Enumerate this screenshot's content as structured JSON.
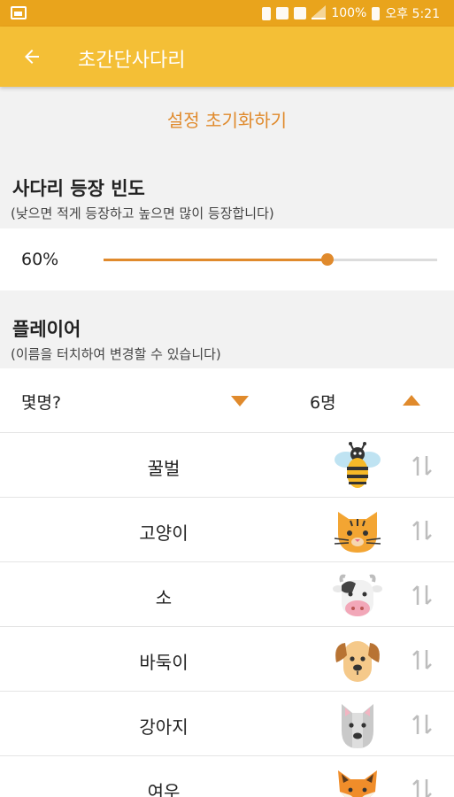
{
  "status_bar": {
    "battery": "100%",
    "time": "오후 5:21"
  },
  "app_bar": {
    "title": "초간단사다리",
    "back_icon": "back-arrow-icon"
  },
  "reset_button": "설정 초기화하기",
  "frequency": {
    "title": "사다리 등장 빈도",
    "subtitle": "(낮으면 적게 등장하고 높으면 많이 등장합니다)",
    "value_label": "60%",
    "value": 0.67
  },
  "players": {
    "title": "플레이어",
    "subtitle": "(이름을 터치하여 변경할 수 있습니다)",
    "count_label": "몇명?",
    "count_value": "6명",
    "items": [
      {
        "name": "꿀벌",
        "icon": "bee-icon"
      },
      {
        "name": "고양이",
        "icon": "cat-icon"
      },
      {
        "name": "소",
        "icon": "cow-icon"
      },
      {
        "name": "바둑이",
        "icon": "dog-brown-icon"
      },
      {
        "name": "강아지",
        "icon": "dog-gray-icon"
      },
      {
        "name": "여우",
        "icon": "fox-icon"
      }
    ]
  },
  "colors": {
    "status_bar": "#e9a41c",
    "app_bar": "#f4bf36",
    "accent": "#e08a2c"
  }
}
